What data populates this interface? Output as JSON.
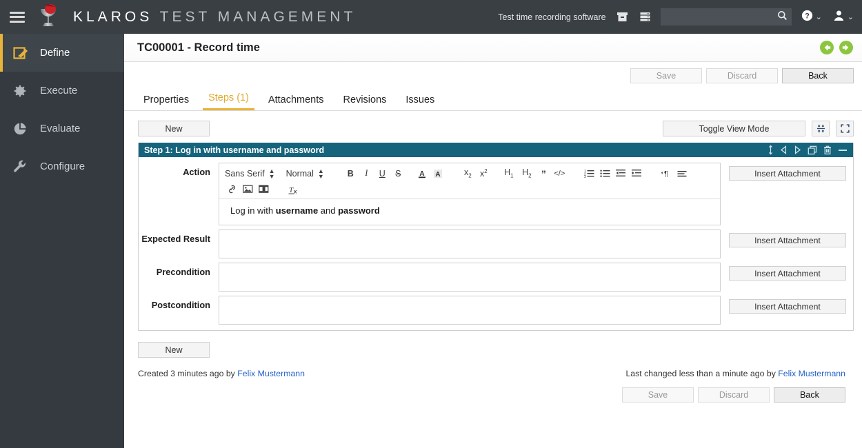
{
  "topbar": {
    "menu_icon": "hamburger-icon",
    "logo_icon": "klaros-logo",
    "brand_primary": "KLAROS",
    "brand_secondary": "TEST MANAGEMENT",
    "project_name": "Test time recording software",
    "icon_archive": "archive-box-icon",
    "icon_database": "database-icon",
    "search_value": "",
    "search_placeholder": "",
    "search_icon": "search-icon",
    "help_icon": "help-circle-icon",
    "user_icon": "user-icon",
    "caret": "⌄"
  },
  "sidebar": {
    "items": [
      {
        "label": "Define",
        "icon": "edit-square-icon",
        "active": true
      },
      {
        "label": "Execute",
        "icon": "gear-icon",
        "active": false
      },
      {
        "label": "Evaluate",
        "icon": "pie-chart-icon",
        "active": false
      },
      {
        "label": "Configure",
        "icon": "wrench-icon",
        "active": false
      }
    ]
  },
  "page": {
    "title": "TC00001 - Record time",
    "nav_prev_icon": "circle-arrow-left-icon",
    "nav_next_icon": "circle-arrow-right-icon"
  },
  "top_actions": {
    "save": "Save",
    "discard": "Discard",
    "back": "Back"
  },
  "tabs": [
    {
      "label": "Properties",
      "active": false
    },
    {
      "label": "Steps (1)",
      "active": true
    },
    {
      "label": "Attachments",
      "active": false
    },
    {
      "label": "Revisions",
      "active": false
    },
    {
      "label": "Issues",
      "active": false
    }
  ],
  "steps_toolbar": {
    "new": "New",
    "toggle_view_mode": "Toggle View Mode",
    "collapse_icon": "collapse-all-icon",
    "expand_icon": "expand-fullscreen-icon"
  },
  "step": {
    "header": "Step 1: Log in with username and password",
    "header_icons": [
      "drag-vertical-icon",
      "move-left-icon",
      "move-right-icon",
      "duplicate-icon",
      "delete-trash-icon",
      "collapse-minus-icon"
    ],
    "editor_toolbar": {
      "font_family": "Sans Serif",
      "font_size": "Normal",
      "buttons": [
        {
          "name": "bold-button",
          "glyph": "B"
        },
        {
          "name": "italic-button",
          "glyph": "I"
        },
        {
          "name": "underline-button",
          "glyph": "U"
        },
        {
          "name": "strikethrough-button",
          "glyph": "S"
        },
        {
          "name": "text-color-button",
          "glyph": "A"
        },
        {
          "name": "highlight-color-button",
          "glyph": "A"
        },
        {
          "name": "subscript-button",
          "glyph": "x"
        },
        {
          "name": "superscript-button",
          "glyph": "x"
        },
        {
          "name": "heading-1-button",
          "glyph": "H1"
        },
        {
          "name": "heading-2-button",
          "glyph": "H2"
        },
        {
          "name": "blockquote-button",
          "glyph": "”"
        },
        {
          "name": "code-block-button",
          "glyph": "</>"
        },
        {
          "name": "ordered-list-button",
          "glyph": "list"
        },
        {
          "name": "bullet-list-button",
          "glyph": "list"
        },
        {
          "name": "outdent-button",
          "glyph": "indent"
        },
        {
          "name": "indent-button",
          "glyph": "indent"
        },
        {
          "name": "text-direction-button",
          "glyph": "¶"
        },
        {
          "name": "align-button",
          "glyph": "align"
        },
        {
          "name": "insert-link-button",
          "glyph": "link"
        },
        {
          "name": "insert-image-button",
          "glyph": "image"
        },
        {
          "name": "insert-video-button",
          "glyph": "video"
        },
        {
          "name": "clear-formatting-button",
          "glyph": "Tx"
        }
      ]
    },
    "fields": [
      {
        "label": "Action",
        "has_editor": true,
        "text_plain_1": "Log in with ",
        "text_bold_1": "username",
        "text_plain_2": " and ",
        "text_bold_2": "password",
        "attachment_button": "Insert Attachment"
      },
      {
        "label": "Expected Result",
        "has_editor": false,
        "value": "",
        "attachment_button": "Insert Attachment"
      },
      {
        "label": "Precondition",
        "has_editor": false,
        "value": "",
        "attachment_button": "Insert Attachment"
      },
      {
        "label": "Postcondition",
        "has_editor": false,
        "value": "",
        "attachment_button": "Insert Attachment"
      }
    ]
  },
  "footer": {
    "new_button": "New",
    "created_prefix": "Created 3 minutes ago by ",
    "created_user": "Felix Mustermann",
    "changed_prefix": "Last changed less than a minute ago by ",
    "changed_user": "Felix Mustermann",
    "save": "Save",
    "discard": "Discard",
    "back": "Back"
  },
  "colors": {
    "topbar_bg": "#3a3f44",
    "sidebar_bg": "#343a40",
    "sidebar_active_bg": "#3e454b",
    "accent_yellow": "#e8b33a",
    "step_header_teal": "#16647c",
    "link_blue": "#2262c6",
    "nav_green": "#8cc63e",
    "logo_red": "#cc2127"
  }
}
